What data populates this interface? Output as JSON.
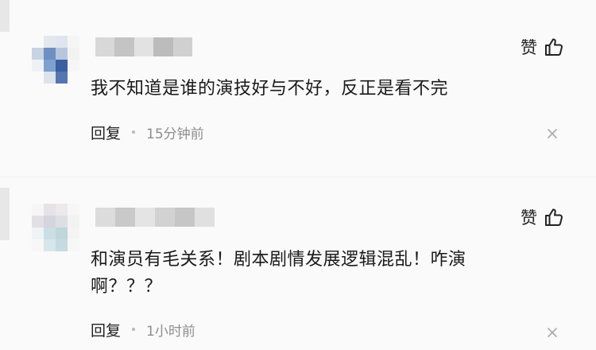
{
  "comments": [
    {
      "text": "我不知道是谁的演技好与不好，反正是看不完",
      "like_label": "赞",
      "reply_label": "回复",
      "timestamp": "15分钟前",
      "avatar_colors": [
        "#fafafa",
        "#e3e8ef",
        "#dfe5ee",
        "#f5f5f5",
        "#c8d3e3",
        "#6f8fc2",
        "#b7c6dd",
        "#f2f2f2",
        "#eef1f6",
        "#7f9fce",
        "#3b5fa0",
        "#f6f6f6",
        "#fafafa",
        "#dde3ec",
        "#5576b0",
        "#fafafa"
      ],
      "name_blur_colors": [
        "#d8d8d8",
        "#c4c4c4",
        "#e2e2e2",
        "#bcbcbc",
        "#d0d0d0"
      ]
    },
    {
      "text": "和演员有毛关系！剧本剧情发展逻辑混乱！咋演啊？？？",
      "like_label": "赞",
      "reply_label": "回复",
      "timestamp": "1小时前",
      "avatar_colors": [
        "#f6f6f6",
        "#e6e2e8",
        "#ece8ec",
        "#f6f6f6",
        "#e3dfe6",
        "#d6d4dc",
        "#dcdfe4",
        "#f2f2f2",
        "#eef3f5",
        "#c9dfe4",
        "#bfd6dd",
        "#f4f4f4",
        "#f7f7f7",
        "#d7e6ea",
        "#c5dbe1",
        "#f7f7f7"
      ],
      "name_blur_colors": [
        "#dcdcdc",
        "#c9c9c9",
        "#e4e4e4",
        "#d2d2d2",
        "#c6c6c6",
        "#e0e0e0"
      ]
    }
  ],
  "colors": {
    "background": "#fafafa",
    "text": "#1a1a1a",
    "secondary_text": "#8e8e8e"
  },
  "icons": {
    "like": "thumbs-up-icon",
    "close": "close-icon"
  }
}
